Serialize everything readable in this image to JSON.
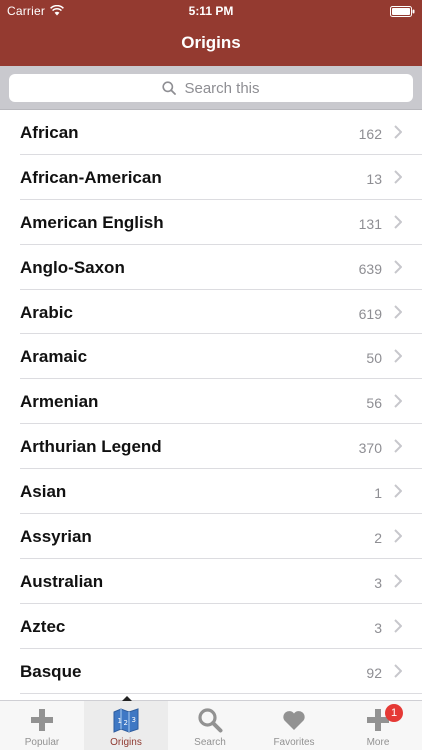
{
  "status_bar": {
    "carrier": "Carrier",
    "time": "5:11 PM",
    "wifi_icon": "wifi-icon",
    "battery_icon": "battery-icon"
  },
  "nav": {
    "title": "Origins",
    "background": "#943a30"
  },
  "search": {
    "placeholder": "Search this",
    "icon": "search-icon"
  },
  "list": {
    "items": [
      {
        "label": "African",
        "count": "162"
      },
      {
        "label": "African-American",
        "count": "13"
      },
      {
        "label": "American English",
        "count": "131"
      },
      {
        "label": "Anglo-Saxon",
        "count": "639"
      },
      {
        "label": "Arabic",
        "count": "619"
      },
      {
        "label": "Aramaic",
        "count": "50"
      },
      {
        "label": "Armenian",
        "count": "56"
      },
      {
        "label": "Arthurian Legend",
        "count": "370"
      },
      {
        "label": "Asian",
        "count": "1"
      },
      {
        "label": "Assyrian",
        "count": "2"
      },
      {
        "label": "Australian",
        "count": "3"
      },
      {
        "label": "Aztec",
        "count": "3"
      },
      {
        "label": "Basque",
        "count": "92"
      }
    ]
  },
  "tab_bar": {
    "tabs": [
      {
        "label": "Popular",
        "icon": "plus-icon"
      },
      {
        "label": "Origins",
        "icon": "map-icon",
        "active": true
      },
      {
        "label": "Search",
        "icon": "magnifier-icon"
      },
      {
        "label": "Favorites",
        "icon": "heart-icon"
      },
      {
        "label": "More",
        "icon": "plus-icon",
        "badge": "1"
      }
    ],
    "active_color": "#8f3a31",
    "badge_color": "#e53935"
  }
}
